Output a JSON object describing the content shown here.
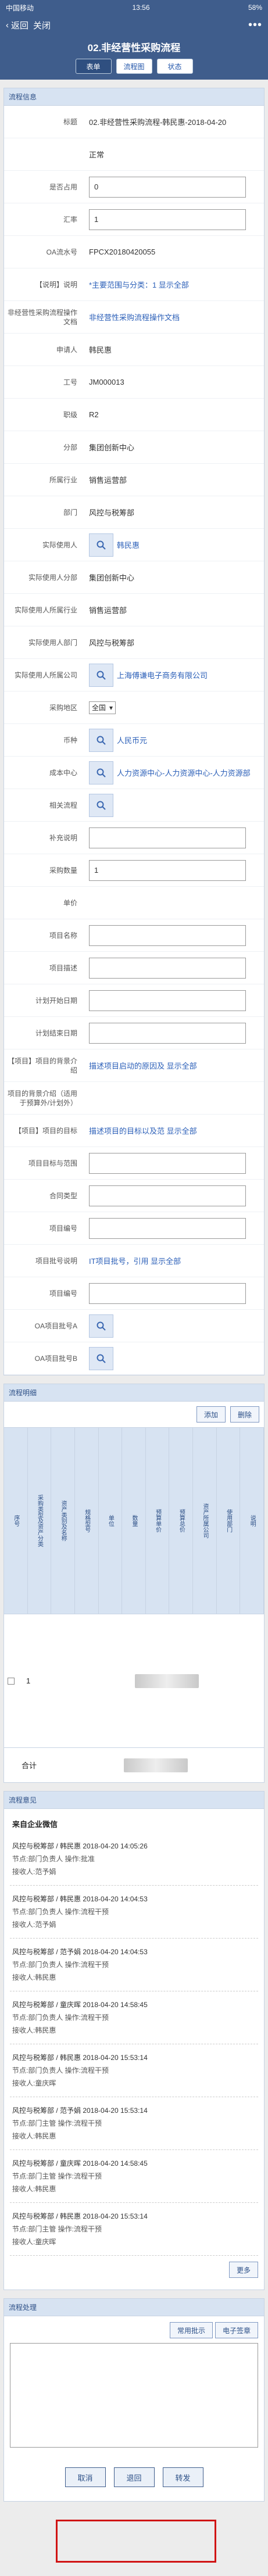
{
  "status": {
    "carrier": "中国移动",
    "time": "13:56",
    "battery": "58%"
  },
  "nav": {
    "back_label": "返回",
    "close_label": "关闭"
  },
  "title": "02.非经营性采购流程",
  "tabs": [
    {
      "label": "表单",
      "active": true
    },
    {
      "label": "流程图",
      "active": false
    },
    {
      "label": "状态",
      "active": false
    }
  ],
  "info": {
    "section_title": "流程信息",
    "fields": [
      {
        "label": "标题",
        "value": "02.非经营性采购流程-韩民惠-2018-04-20"
      },
      {
        "label": "",
        "value": "正常"
      },
      {
        "label": "是否占用",
        "value": "0"
      },
      {
        "label": "汇率",
        "value": "1"
      },
      {
        "label": "OA流水号",
        "value": "FPCX20180420055"
      },
      {
        "label": "【说明】说明",
        "value": "*主要范围与分类：1 显示全部"
      },
      {
        "label": "非经营性采购流程操作文档",
        "value": "非经营性采购流程操作文档"
      },
      {
        "label": "申请人",
        "value": "韩民惠"
      },
      {
        "label": "工号",
        "value": "JM000013"
      },
      {
        "label": "职级",
        "value": "R2"
      },
      {
        "label": "分部",
        "value": "集团创新中心"
      },
      {
        "label": "所属行业",
        "value": "销售运营部"
      },
      {
        "label": "部门",
        "value": "风控与税筹部"
      },
      {
        "label": "实际使用人",
        "value": "韩民惠"
      },
      {
        "label": "实际使用人分部",
        "value": "集团创新中心"
      },
      {
        "label": "实际使用人所属行业",
        "value": "销售运营部"
      },
      {
        "label": "实际使用人部门",
        "value": "风控与税筹部"
      },
      {
        "label": "实际使用人所属公司",
        "value": "上海傅谦电子商务有限公司"
      },
      {
        "label": "采购地区",
        "value": "全国"
      },
      {
        "label": "币种",
        "value": "人民币元"
      },
      {
        "label": "成本中心",
        "value": "人力资源中心-人力资源中心-人力资源部"
      },
      {
        "label": "相关流程",
        "value": ""
      },
      {
        "label": "补充说明",
        "value": ""
      },
      {
        "label": "采购数量",
        "value": "1"
      },
      {
        "label": "单价",
        "value": ""
      },
      {
        "label": "项目名称",
        "value": ""
      },
      {
        "label": "项目描述",
        "value": ""
      },
      {
        "label": "计划开始日期",
        "value": ""
      },
      {
        "label": "计划结束日期",
        "value": ""
      },
      {
        "label": "【项目】项目的背景介绍",
        "value": "描述项目启动的原因及 显示全部"
      },
      {
        "label": "项目的背景介绍（适用于预算外/计划外）",
        "value": ""
      },
      {
        "label": "【项目】项目的目标",
        "value": "描述项目的目标以及范 显示全部"
      },
      {
        "label": "项目目标与范围",
        "value": ""
      },
      {
        "label": "合同类型",
        "value": ""
      },
      {
        "label": "项目编号",
        "value": ""
      },
      {
        "label": "项目批号说明",
        "value": "IT项目批号，引用 显示全部"
      },
      {
        "label": "项目编号",
        "value": ""
      },
      {
        "label": "OA项目批号A",
        "value": ""
      },
      {
        "label": "OA项目批号B",
        "value": ""
      }
    ]
  },
  "detail": {
    "section_title": "流程明细",
    "add_label": "添加",
    "delete_label": "删除",
    "headers": [
      "序号",
      "采购类型及资产分类",
      "资产类别及名称",
      "规格型号",
      "单位",
      "数量",
      "预算单价",
      "预算总价",
      "资产所属公司",
      "使用部门",
      "说明"
    ],
    "row_index": "1",
    "total_label": "合计"
  },
  "opinion": {
    "section_title": "流程意见",
    "source": "来自企业微信",
    "items": [
      {
        "who": "风控与税筹部 / 韩民惠 2018-04-20 14:05:26",
        "node": "节点:部门负责人  操作:批准",
        "recv": "接收人:范予娟"
      },
      {
        "who": "风控与税筹部 / 韩民惠 2018-04-20 14:04:53",
        "node": "节点:部门负责人  操作:流程干预",
        "recv": "接收人:范予娟"
      },
      {
        "who": "风控与税筹部 / 范予娟 2018-04-20 14:04:53",
        "node": "节点:部门负责人  操作:流程干预",
        "recv": "接收人:韩民惠"
      },
      {
        "who": "风控与税筹部 / 童庆晖 2018-04-20 14:58:45",
        "node": "节点:部门负责人  操作:流程干预",
        "recv": "接收人:韩民惠"
      },
      {
        "who": "风控与税筹部 / 韩民惠 2018-04-20 15:53:14",
        "node": "节点:部门负责人  操作:流程干预",
        "recv": "接收人:童庆晖"
      },
      {
        "who": "风控与税筹部 / 范予娟 2018-04-20 15:53:14",
        "node": "节点:部门主管  操作:流程干预",
        "recv": "接收人:韩民惠"
      },
      {
        "who": "风控与税筹部 / 童庆晖 2018-04-20 14:58:45",
        "node": "节点:部门主管  操作:流程干预",
        "recv": "接收人:韩民惠"
      },
      {
        "who": "风控与税筹部 / 韩民惠 2018-04-20 15:53:14",
        "node": "节点:部门主管  操作:流程干预",
        "recv": "接收人:童庆晖"
      }
    ],
    "more_label": "更多"
  },
  "handle": {
    "section_title": "流程处理",
    "common_label": "常用批示",
    "sign_label": "电子签章",
    "cancel_label": "取消",
    "return_label": "退回",
    "forward_label": "转发"
  }
}
